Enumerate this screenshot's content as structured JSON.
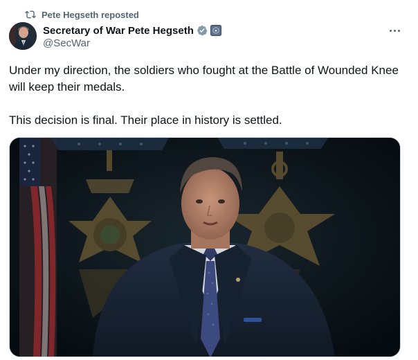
{
  "repost": {
    "text": "Pete Hegseth reposted",
    "icon": "repost-icon"
  },
  "author": {
    "display_name": "Secretary of War Pete Hegseth",
    "handle": "@SecWar",
    "verified_icon": "verified-badge-icon",
    "affiliation_icon": "government-affiliation-icon"
  },
  "post": {
    "paragraphs": [
      "Under my direction, the soldiers who fought at the Battle of Wounded Knee will keep their medals.",
      "This decision is final. Their place in history is settled."
    ]
  },
  "media": {
    "type": "video-frame",
    "description_icon": "video-thumbnail"
  },
  "colors": {
    "text": "#0f1419",
    "secondary": "#536471",
    "verified": "#829aab"
  }
}
